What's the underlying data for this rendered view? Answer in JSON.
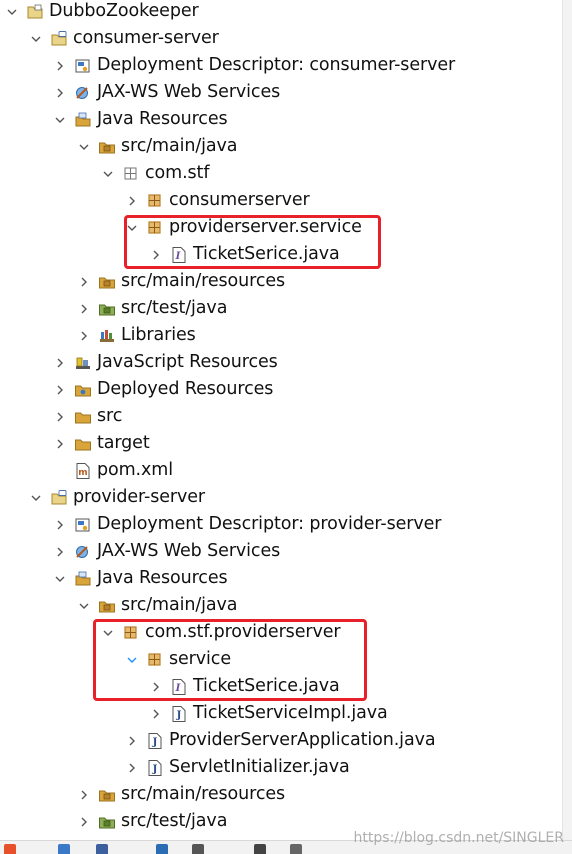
{
  "colors": {
    "highlight_box": "#e8202a",
    "selection_chevron": "#1e90ff",
    "package_icon": "#b7802c",
    "folder_icon": "#d9a53b",
    "java_file_icon": "#2b4a8b",
    "interface_icon": "#6a4fa0"
  },
  "tree": [
    {
      "label": "DubboZookeeper",
      "depth": 0,
      "chevron": "down",
      "icon": "project-icon"
    },
    {
      "label": "consumer-server",
      "depth": 1,
      "chevron": "down",
      "icon": "web-project-icon"
    },
    {
      "label": "Deployment Descriptor: consumer-server",
      "depth": 2,
      "chevron": "right",
      "icon": "deployment-descriptor-icon"
    },
    {
      "label": "JAX-WS Web Services",
      "depth": 2,
      "chevron": "right",
      "icon": "web-services-icon"
    },
    {
      "label": "Java Resources",
      "depth": 2,
      "chevron": "down",
      "icon": "java-resources-icon"
    },
    {
      "label": "src/main/java",
      "depth": 3,
      "chevron": "down",
      "icon": "source-folder-icon"
    },
    {
      "label": "com.stf",
      "depth": 4,
      "chevron": "down",
      "icon": "empty-package-icon"
    },
    {
      "label": "consumerserver",
      "depth": 5,
      "chevron": "right",
      "icon": "package-icon"
    },
    {
      "label": "providerserver.service",
      "depth": 5,
      "chevron": "down",
      "icon": "package-icon"
    },
    {
      "label": "TicketSerice.java",
      "depth": 6,
      "chevron": "right",
      "icon": "interface-file-icon"
    },
    {
      "label": "src/main/resources",
      "depth": 3,
      "chevron": "right",
      "icon": "source-folder-icon"
    },
    {
      "label": "src/test/java",
      "depth": 3,
      "chevron": "right",
      "icon": "test-folder-icon"
    },
    {
      "label": "Libraries",
      "depth": 3,
      "chevron": "right",
      "icon": "libraries-icon"
    },
    {
      "label": "JavaScript Resources",
      "depth": 2,
      "chevron": "right",
      "icon": "javascript-resources-icon"
    },
    {
      "label": "Deployed Resources",
      "depth": 2,
      "chevron": "right",
      "icon": "deployed-resources-icon"
    },
    {
      "label": "src",
      "depth": 2,
      "chevron": "right",
      "icon": "folder-icon"
    },
    {
      "label": "target",
      "depth": 2,
      "chevron": "right",
      "icon": "folder-icon"
    },
    {
      "label": "pom.xml",
      "depth": 2,
      "chevron": "none",
      "icon": "xml-file-icon"
    },
    {
      "label": "provider-server",
      "depth": 1,
      "chevron": "down",
      "icon": "web-project-icon"
    },
    {
      "label": "Deployment Descriptor: provider-server",
      "depth": 2,
      "chevron": "right",
      "icon": "deployment-descriptor-icon"
    },
    {
      "label": "JAX-WS Web Services",
      "depth": 2,
      "chevron": "right",
      "icon": "web-services-icon"
    },
    {
      "label": "Java Resources",
      "depth": 2,
      "chevron": "down",
      "icon": "java-resources-icon"
    },
    {
      "label": "src/main/java",
      "depth": 3,
      "chevron": "down",
      "icon": "source-folder-icon"
    },
    {
      "label": "com.stf.providerserver",
      "depth": 4,
      "chevron": "down",
      "icon": "package-icon"
    },
    {
      "label": "service",
      "depth": 5,
      "chevron": "down-selected",
      "icon": "package-icon"
    },
    {
      "label": "TicketSerice.java",
      "depth": 6,
      "chevron": "right",
      "icon": "interface-file-icon"
    },
    {
      "label": "TicketServiceImpl.java",
      "depth": 6,
      "chevron": "right",
      "icon": "java-file-icon"
    },
    {
      "label": "ProviderServerApplication.java",
      "depth": 5,
      "chevron": "right",
      "icon": "java-file-icon"
    },
    {
      "label": "ServletInitializer.java",
      "depth": 5,
      "chevron": "right",
      "icon": "java-file-icon"
    },
    {
      "label": "src/main/resources",
      "depth": 3,
      "chevron": "right",
      "icon": "source-folder-icon"
    },
    {
      "label": "src/test/java",
      "depth": 3,
      "chevron": "right",
      "icon": "test-folder-icon"
    }
  ],
  "watermark": "https://blog.csdn.net/SINGLER"
}
